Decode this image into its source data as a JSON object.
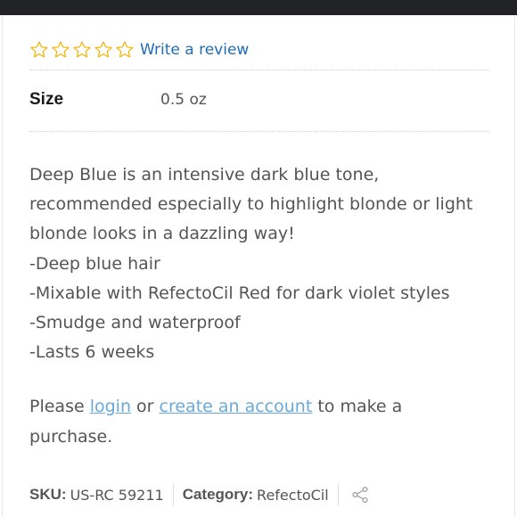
{
  "rating": {
    "stars_filled": 0,
    "stars_total": 5,
    "star_color": "#f0b400",
    "review_link": "Write a review"
  },
  "attributes": {
    "size_label": "Size",
    "size_value": "0.5 oz"
  },
  "description": {
    "lines": [
      "Deep Blue is an intensive dark blue tone,",
      "recommended especially to highlight blonde or light",
      "blonde looks in a dazzling way!",
      "-Deep blue hair",
      "-Mixable with RefectoCil Red for dark violet styles",
      "-Smudge and waterproof",
      "-Lasts 6 weeks"
    ]
  },
  "purchase": {
    "prefix": "Please ",
    "login_link": "login",
    "middle": " or ",
    "create_account_link": "create an account",
    "suffix_line1": " to make a",
    "suffix_line2": "purchase."
  },
  "meta": {
    "sku_label": "SKU:",
    "sku_value": "US-RC 59211",
    "category_label": "Category:",
    "category_value": "RefectoCil",
    "share_icon": "share-icon"
  },
  "colors": {
    "top_bar": "#222326",
    "link": "#1f6db5",
    "light_link": "#6aa8d8",
    "text": "#555555"
  }
}
